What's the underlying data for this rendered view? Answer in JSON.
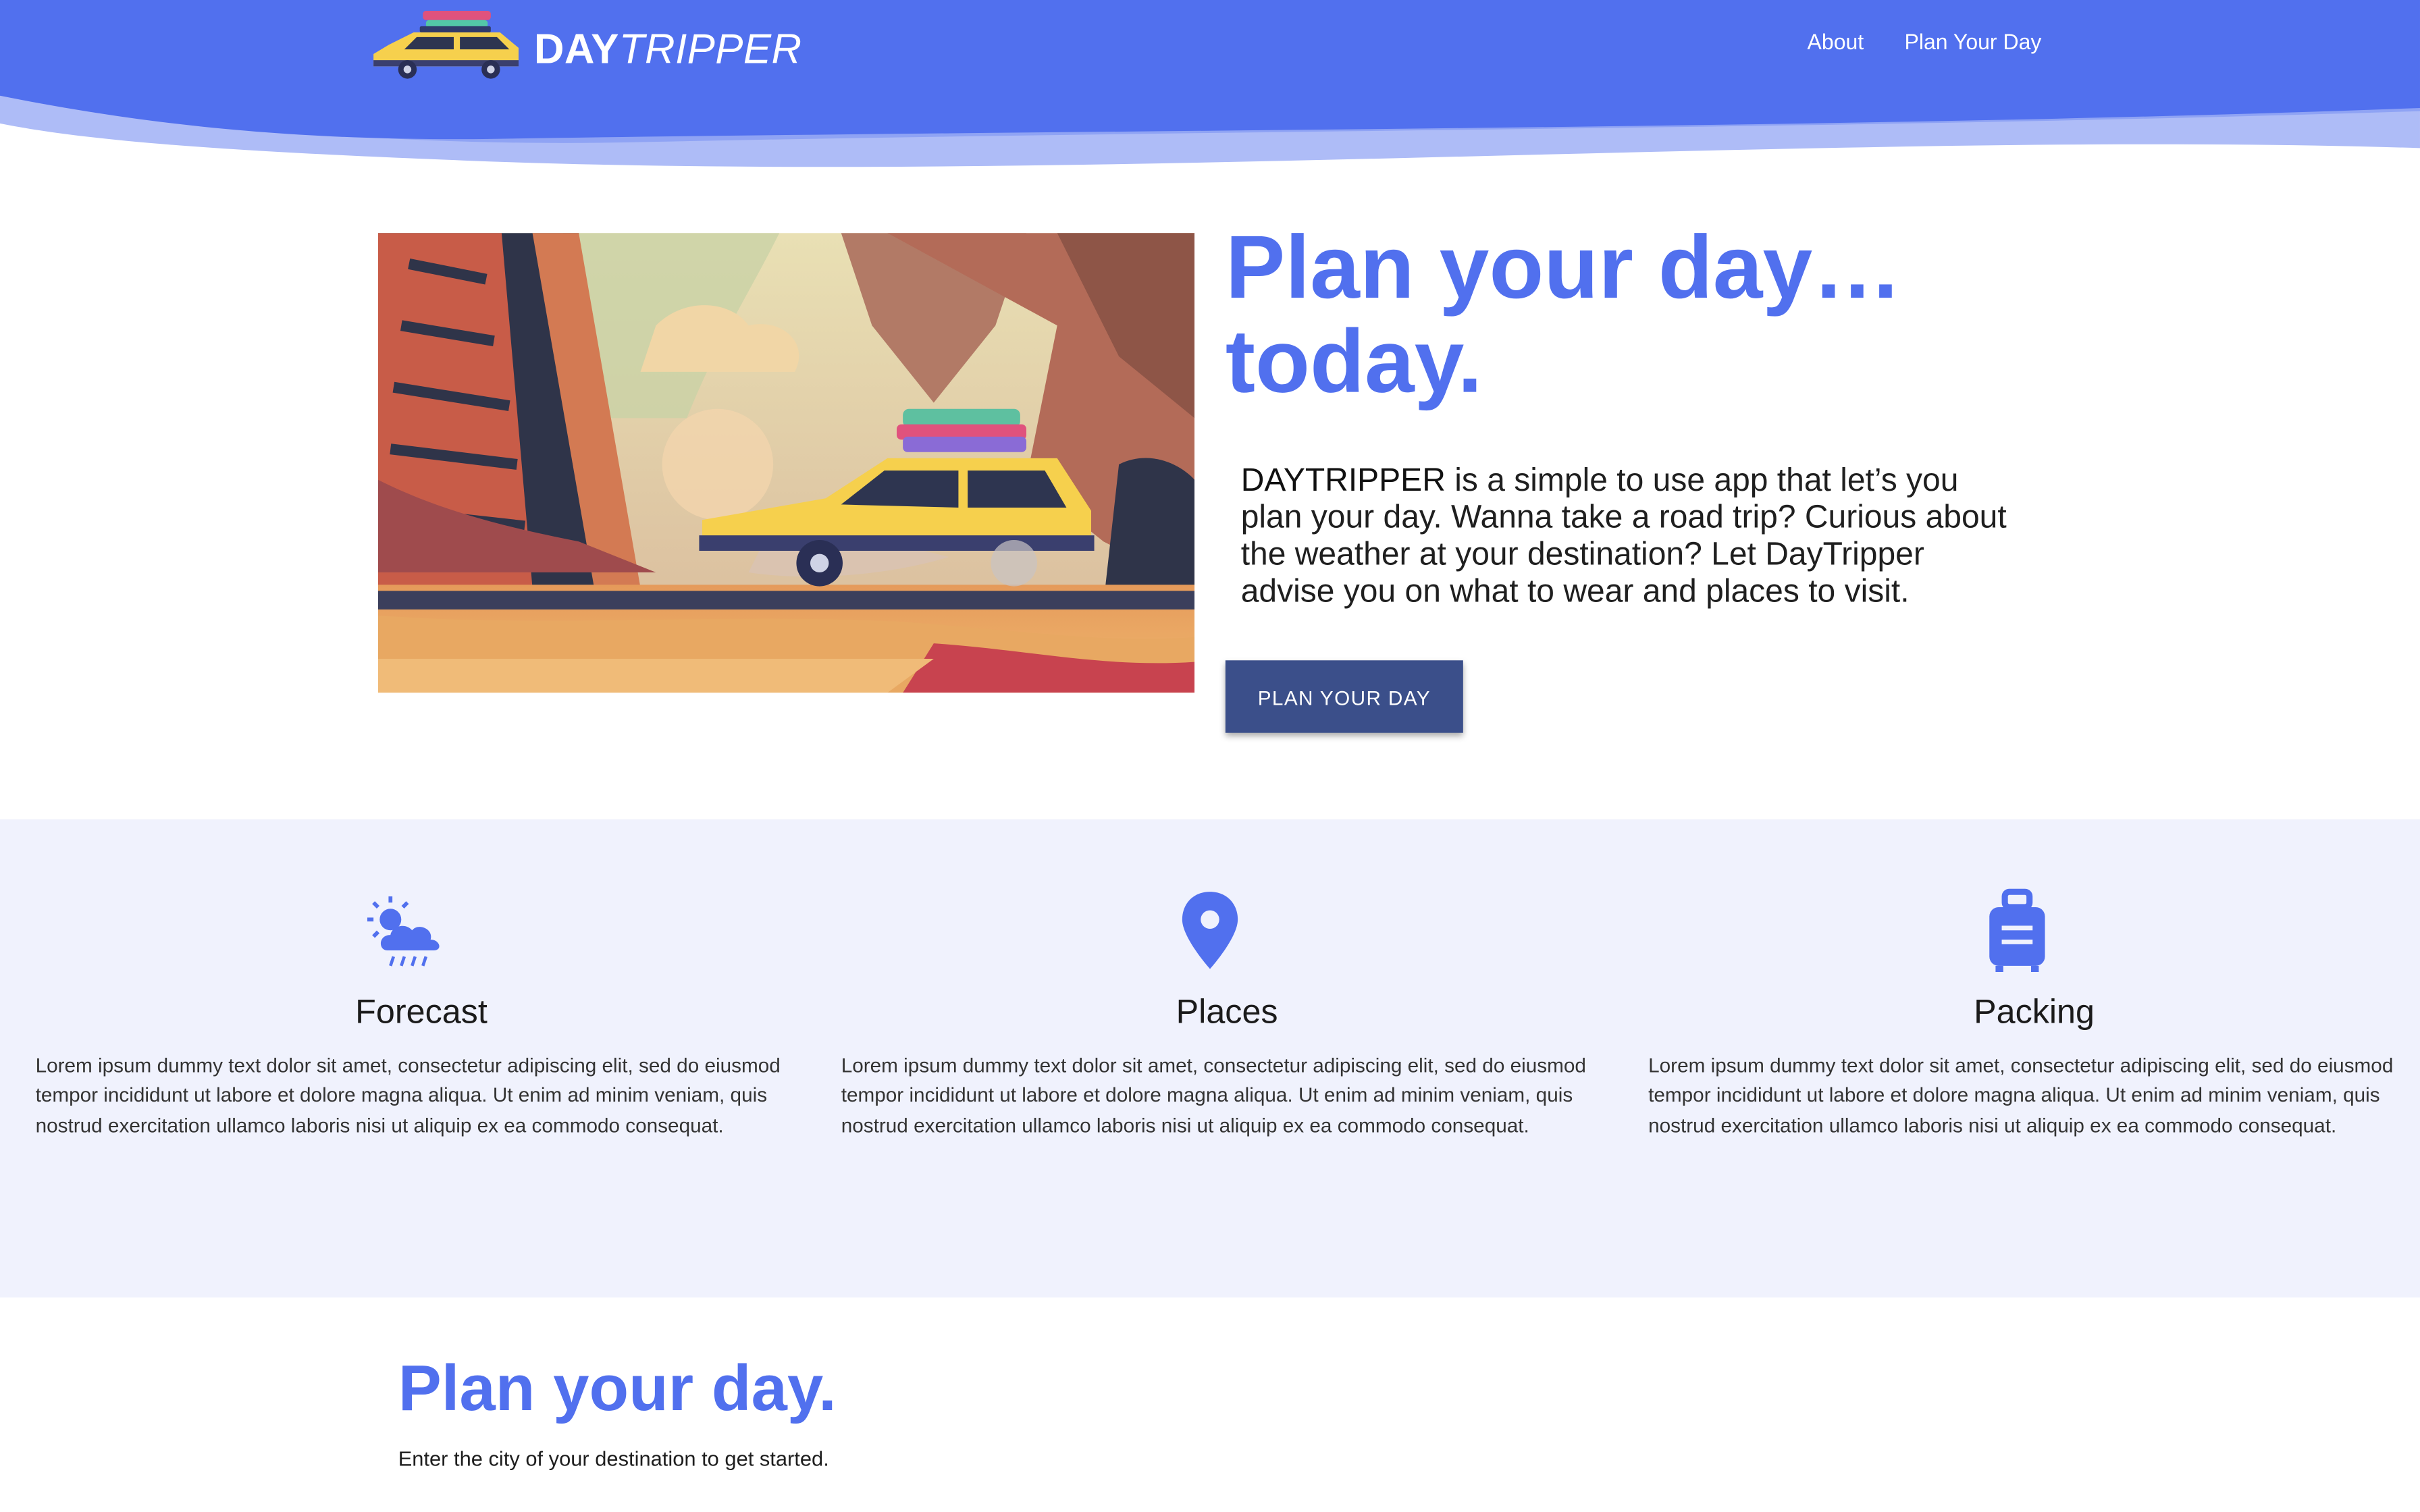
{
  "brand": {
    "bold": "DAY",
    "italic": "TRIPPER"
  },
  "nav": {
    "about": "About",
    "plan": "Plan Your Day"
  },
  "hero": {
    "title": "Plan your day…\ntoday.",
    "desc_brand": "DAYTRIPPER",
    "desc_rest": " is a simple to use app that let’s you plan your day. Wanna take a road trip? Curious about the weather at your destination? Let DayTripper advise you on what to wear and places to visit.",
    "cta": "PLAN YOUR DAY"
  },
  "features": [
    {
      "title": "Forecast",
      "icon": "weather-icon",
      "text": "Lorem ipsum dummy text dolor sit amet, consectetur adipiscing elit, sed do eiusmod tempor incididunt ut labore et dolore magna aliqua. Ut enim ad minim veniam, quis nostrud exercitation ullamco laboris nisi ut aliquip ex ea commodo consequat."
    },
    {
      "title": "Places",
      "icon": "map-pin-icon",
      "text": "Lorem ipsum dummy text dolor sit amet, consectetur adipiscing elit, sed do eiusmod tempor incididunt ut labore et dolore magna aliqua. Ut enim ad minim veniam, quis nostrud exercitation ullamco laboris nisi ut aliquip ex ea commodo consequat."
    },
    {
      "title": "Packing",
      "icon": "suitcase-icon",
      "text": "Lorem ipsum dummy text dolor sit amet, consectetur adipiscing elit, sed do eiusmod tempor incididunt ut labore et dolore magna aliqua. Ut enim ad minim veniam, quis nostrud exercitation ullamco laboris nisi ut aliquip ex ea commodo consequat."
    }
  ],
  "plan": {
    "title": "Plan your day.",
    "subtitle": "Enter the city of your destination to get started."
  },
  "colors": {
    "primary": "#5170ee",
    "button": "#3b4f8a",
    "features_bg": "#f0f2fd"
  }
}
